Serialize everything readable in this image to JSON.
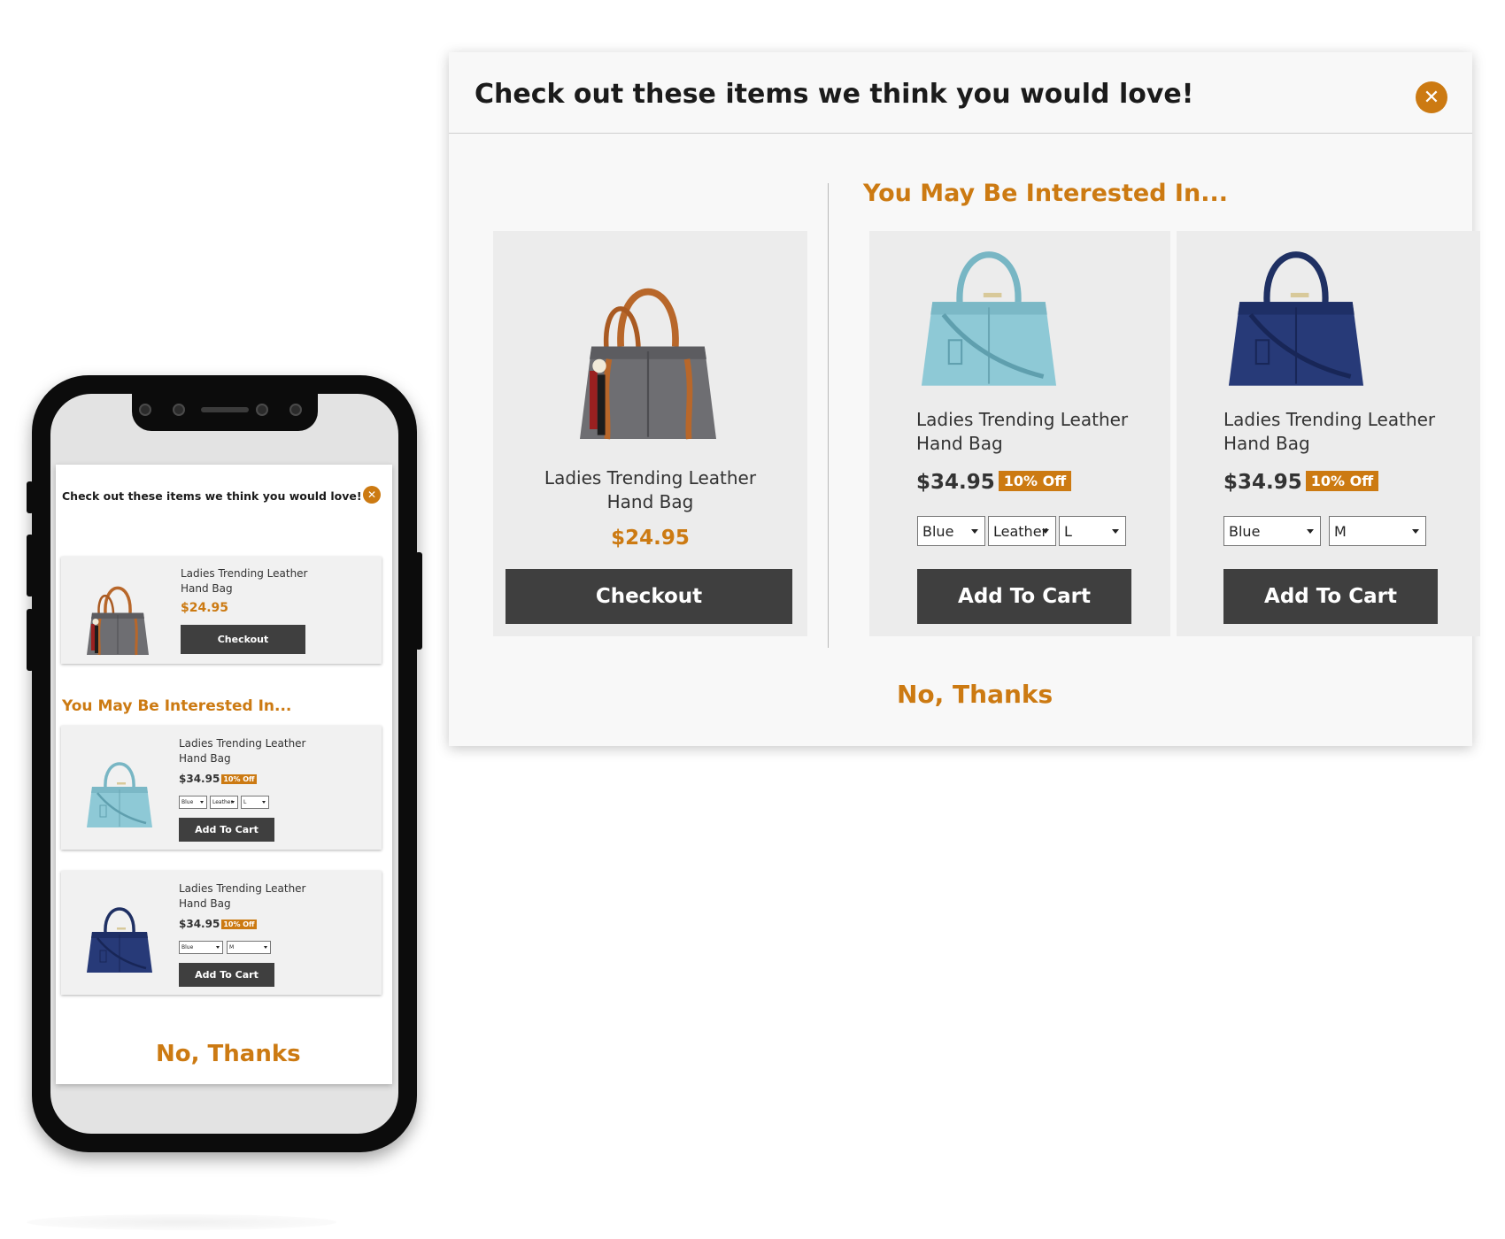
{
  "desktop": {
    "title": "Check out these items we think you would love!",
    "close_icon": "close-icon",
    "subheading": "You May Be Interested In...",
    "main_product": {
      "name": "Ladies Trending Leather Hand Bag",
      "price": "$24.95",
      "button": "Checkout",
      "image": "gray-handbag-image"
    },
    "recommendations": [
      {
        "name": "Ladies Trending Leather Hand Bag",
        "price": "$34.95",
        "badge": "10% Off",
        "selects": [
          "Blue",
          "Leather",
          "L"
        ],
        "button": "Add To Cart",
        "image": "light-blue-handbag-image"
      },
      {
        "name": "Ladies Trending Leather Hand Bag",
        "price": "$34.95",
        "badge": "10% Off",
        "selects": [
          "Blue",
          "M"
        ],
        "button": "Add To Cart",
        "image": "navy-handbag-image"
      }
    ],
    "no_thanks": "No, Thanks"
  },
  "mobile": {
    "title": "Check out these items we think you would love!",
    "subheading": "You May Be Interested In...",
    "main_product": {
      "name": "Ladies Trending Leather Hand Bag",
      "price": "$24.95",
      "button": "Checkout"
    },
    "recommendations": [
      {
        "name": "Ladies Trending Leather Hand Bag",
        "price": "$34.95",
        "badge": "10% Off",
        "selects": [
          "Blue",
          "Leather",
          "L"
        ],
        "button": "Add To Cart"
      },
      {
        "name": "Ladies Trending Leather Hand Bag",
        "price": "$34.95",
        "badge": "10% Off",
        "selects": [
          "Blue",
          "M"
        ],
        "button": "Add To Cart"
      }
    ],
    "no_thanks": "No, Thanks"
  },
  "colors": {
    "accent": "#cc7a12",
    "button_dark": "#3f3f3f",
    "card_bg": "#ececec",
    "popup_bg": "#f8f8f8"
  }
}
